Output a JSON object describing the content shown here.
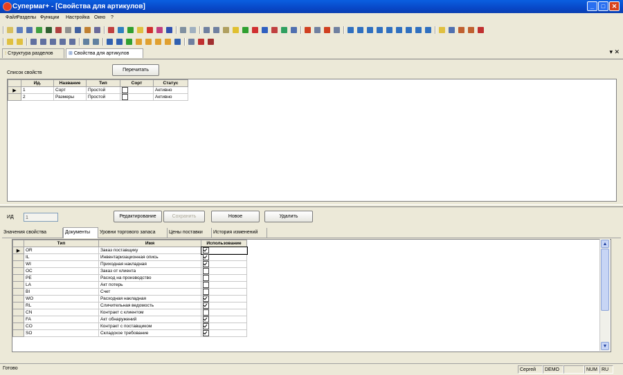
{
  "window": {
    "title": "Супермаг+ - [Свойства для артикулов]"
  },
  "menu": [
    "Файл",
    "Разделы",
    "Функции",
    "Настройка",
    "Окно",
    "?"
  ],
  "tabs": [
    {
      "label": "Структура разделов",
      "active": false
    },
    {
      "label": "Свойства для артикулов",
      "active": true
    }
  ],
  "top": {
    "list_label": "Список свойств",
    "reread_button": "Перечитать",
    "columns": [
      "Ид.",
      "Название",
      "Тип",
      "Сорт",
      "Статус"
    ],
    "rows": [
      {
        "id": "1",
        "name": "Сорт",
        "type": "Простой",
        "sort": false,
        "status": "Активно",
        "current": true
      },
      {
        "id": "2",
        "name": "Размеры",
        "type": "Простой",
        "sort": false,
        "status": "Активно",
        "current": false
      }
    ]
  },
  "form": {
    "id_label": "ИД",
    "id_value": "1",
    "buttons": {
      "edit": "Редактирование",
      "save": "Сохранить",
      "new": "Новое",
      "delete": "Удалить"
    }
  },
  "subtabs": [
    {
      "label": "Значения свойства",
      "active": false
    },
    {
      "label": "Документы",
      "active": true
    },
    {
      "label": "Уровни торгового запаса",
      "active": false
    },
    {
      "label": "Цены поставки",
      "active": false
    },
    {
      "label": "История изменений",
      "active": false
    }
  ],
  "docs": {
    "columns": [
      "Тип",
      "Имя",
      "Использование"
    ],
    "rows": [
      {
        "type": "OR",
        "name": "Заказ поставщику",
        "use": true
      },
      {
        "type": "IL",
        "name": "Инвентаризационная опись",
        "use": true
      },
      {
        "type": "WI",
        "name": "Приходная накладная",
        "use": true
      },
      {
        "type": "OC",
        "name": "Заказ от клиента",
        "use": false
      },
      {
        "type": "PE",
        "name": "Расход на производство",
        "use": false
      },
      {
        "type": "LA",
        "name": "Акт потерь",
        "use": false
      },
      {
        "type": "BI",
        "name": "Счет",
        "use": false
      },
      {
        "type": "WO",
        "name": "Расходная накладная",
        "use": true
      },
      {
        "type": "RL",
        "name": "Сличительная ведомость",
        "use": true
      },
      {
        "type": "CN",
        "name": "Контракт с клиентом",
        "use": false
      },
      {
        "type": "FA",
        "name": "Акт обнаружений",
        "use": true
      },
      {
        "type": "CO",
        "name": "Контракт с поставщиком",
        "use": true
      },
      {
        "type": "SO",
        "name": "Складское требование",
        "use": true
      }
    ]
  },
  "status": {
    "text": "Готово",
    "user": "Сергей",
    "db": "DEMO",
    "num": "NUM",
    "lang": "RU"
  },
  "colors": {
    "titlebar": "#0a5fe0",
    "face": "#ece9d8",
    "close": "#d8431c"
  }
}
